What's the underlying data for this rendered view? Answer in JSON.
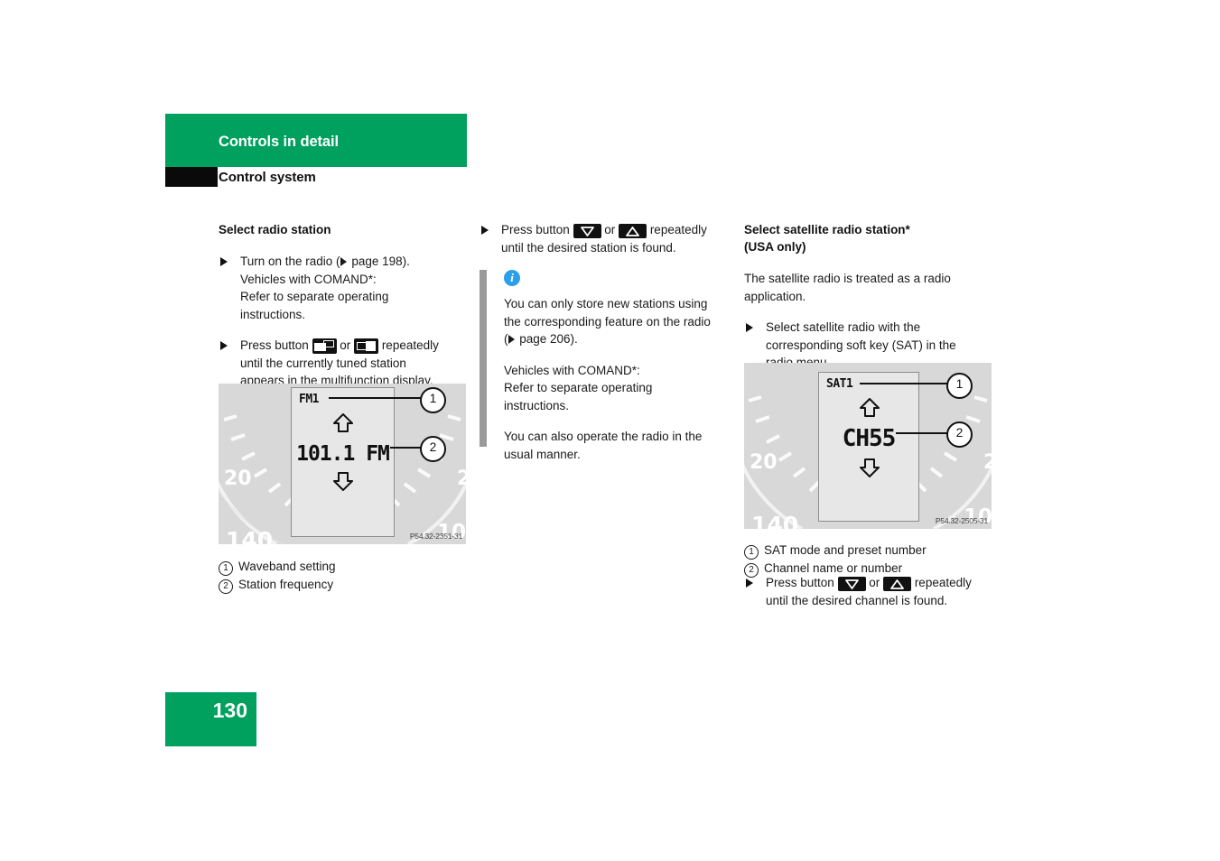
{
  "header": {
    "chapter": "Controls in detail",
    "section": "Control system"
  },
  "footer": {
    "page_number": "130"
  },
  "colors": {
    "brand_green": "#00A05E",
    "info_blue": "#2b9fe8",
    "note_bar_gray": "#9a9a9a",
    "black_tab": "#0a0a0a"
  },
  "left_column": {
    "heading": "Select radio station",
    "bullet1": {
      "line1_pre": "Turn on the radio (",
      "line1_post": " page 198).",
      "line2": "Vehicles with COMAND*:",
      "line3": "Refer to separate operating",
      "line4": "instructions."
    },
    "bullet2": {
      "pre": "Press button ",
      "mid": " or ",
      "post": " repeatedly",
      "line2": "until the currently tuned station",
      "line3": "appears in the multifunction display.",
      "icon1": "window-left-icon",
      "icon2": "window-right-icon"
    },
    "figure": {
      "lcd_mode": "FM1",
      "lcd_value": "101.1 FM",
      "gauge_labels": [
        "20",
        "140",
        "10"
      ],
      "code": "P54.32-2351-31",
      "callout_1": "1",
      "callout_2": "2"
    },
    "captions": [
      {
        "num": "1",
        "text": "Waveband setting"
      },
      {
        "num": "2",
        "text": "Station frequency"
      }
    ]
  },
  "middle_column": {
    "bullet1": {
      "pre": "Press button ",
      "mid": " or ",
      "post": " repeatedly",
      "line2": "until the desired station is found.",
      "icon1": "arrow-down-button-icon",
      "icon2": "arrow-up-button-icon"
    },
    "note": {
      "icon": "info-icon",
      "p1_line1": "You can only store new stations using",
      "p1_line2": "the corresponding feature on the radio",
      "p1_line3_pre": "(",
      "p1_line3_post": " page 206).",
      "p2_line1": "Vehicles with COMAND*:",
      "p2_line2": "Refer to separate operating",
      "p2_line3": "instructions.",
      "p3_line1": "You can also operate the radio in the",
      "p3_line2": "usual manner."
    }
  },
  "right_column": {
    "heading_line1": "Select satellite radio station*",
    "heading_line2": "(USA only)",
    "para1_line1": "The satellite radio is treated as a radio",
    "para1_line2": "application.",
    "bullet1": {
      "line1": "Select satellite radio with the",
      "line2": "corresponding soft key (SAT) in the",
      "line3": "radio menu."
    },
    "figure": {
      "lcd_mode": "SAT1",
      "lcd_value": "CH55",
      "gauge_labels": [
        "20",
        "140",
        "10"
      ],
      "code": "P54.32-2505-31",
      "callout_1": "1",
      "callout_2": "2"
    },
    "captions": [
      {
        "num": "1",
        "text": "SAT mode and preset number"
      },
      {
        "num": "2",
        "text": "Channel name or number"
      }
    ],
    "bullet2": {
      "pre": "Press button ",
      "mid": " or ",
      "post": " repeatedly",
      "line2": "until the desired channel is found.",
      "icon1": "arrow-down-button-icon",
      "icon2": "arrow-up-button-icon"
    }
  }
}
